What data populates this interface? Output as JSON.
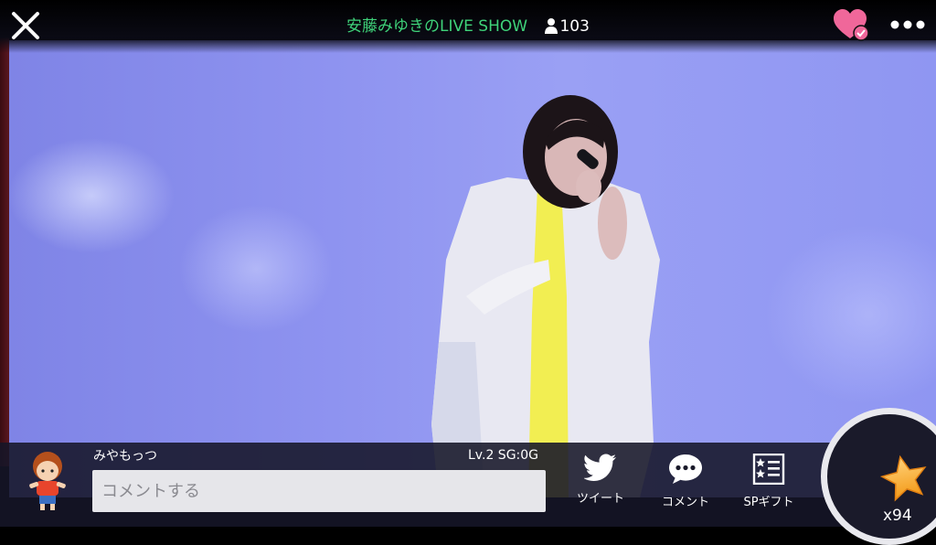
{
  "header": {
    "title": "安藤みゆきのLIVE SHOW",
    "viewer_count": "103",
    "icons": [
      "close-icon",
      "person-icon",
      "heart-check-icon",
      "more-dots-icon"
    ]
  },
  "colors": {
    "title": "#3fd37a",
    "heart": "#f0679a",
    "stage": "#8e93f0"
  },
  "user": {
    "name": "みやもっつ",
    "level": "Lv.2  SG:0G"
  },
  "comment": {
    "placeholder": "コメントする"
  },
  "actions": [
    {
      "label": "ツイート",
      "icon": "twitter-bird-icon"
    },
    {
      "label": "コメント",
      "icon": "speech-bubble-icon"
    },
    {
      "label": "SPギフト",
      "icon": "star-list-icon"
    }
  ],
  "stars": {
    "count": "x94",
    "icon": "star-icon"
  }
}
